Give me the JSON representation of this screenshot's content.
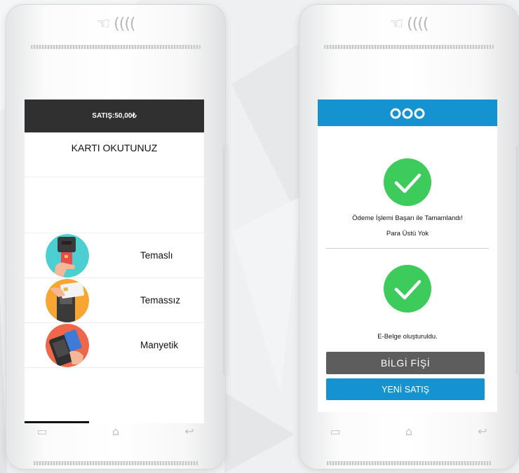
{
  "left_terminal": {
    "sale_header": "SATIŞ:50,00₺",
    "title": "KARTI OKUTUNUZ",
    "methods": [
      {
        "label": "Temaslı",
        "icon": "chip-card-insert-icon"
      },
      {
        "label": "Temassız",
        "icon": "contactless-tap-icon"
      },
      {
        "label": "Manyetik",
        "icon": "magnetic-swipe-icon"
      }
    ]
  },
  "right_terminal": {
    "brand": "ooo",
    "payment_message": "Ödeme İşlemi Başarı ile Tamamlandı!",
    "change_message": "Para Üstü Yok",
    "ebelge_message": "E-Belge oluşturuldu.",
    "info_button": "BİLGİ FİŞİ",
    "new_sale_button": "YENİ SATIŞ"
  },
  "colors": {
    "header_dark": "#303030",
    "brand_blue": "#1593d1",
    "success_green": "#3dcb5c",
    "info_button_grey": "#5d5d5d"
  },
  "nav_icons": [
    "recent-apps-icon",
    "home-icon",
    "back-icon"
  ]
}
